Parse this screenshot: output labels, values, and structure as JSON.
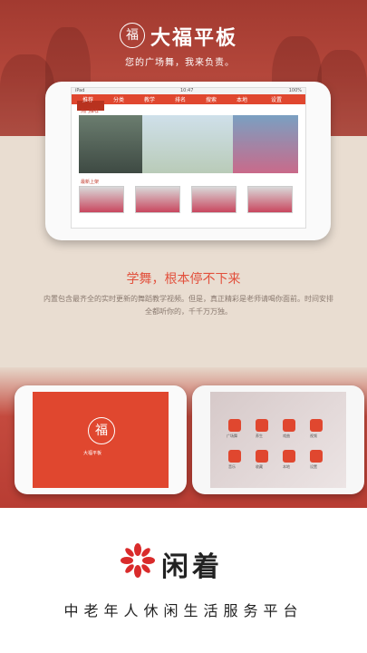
{
  "header": {
    "brand_name": "大福平板",
    "seal_char": "福",
    "slogan": "您的广场舞，我来负责。"
  },
  "tablet_top": {
    "status_left": "iPad",
    "status_time": "10:47",
    "status_right": "100%",
    "nav": [
      "推荐",
      "分类",
      "教学",
      "排名",
      "搜索",
      "本地",
      "设置"
    ],
    "section1": "热门推荐",
    "section2": "最新上架"
  },
  "tagline": "学舞，根本停不下来",
  "description": "内置包含最齐全的实时更新的舞蹈教学视频。但是，真正精彩是老师请喝你面前。时间安排全都听你的，千千万万独。",
  "tablet_left": {
    "logo_char": "福",
    "caption": "大福平板"
  },
  "tablet_right": {
    "labels": [
      "广场舞",
      "养生",
      "戏曲",
      "视频",
      "音乐",
      "收藏",
      "本地",
      "设置"
    ]
  },
  "footer": {
    "brand": "闲着",
    "platform": "中老年人休闲生活服务平台"
  },
  "colors": {
    "accent": "#e0472f",
    "hero": "#b4473b",
    "beige": "#e9ddd1"
  }
}
